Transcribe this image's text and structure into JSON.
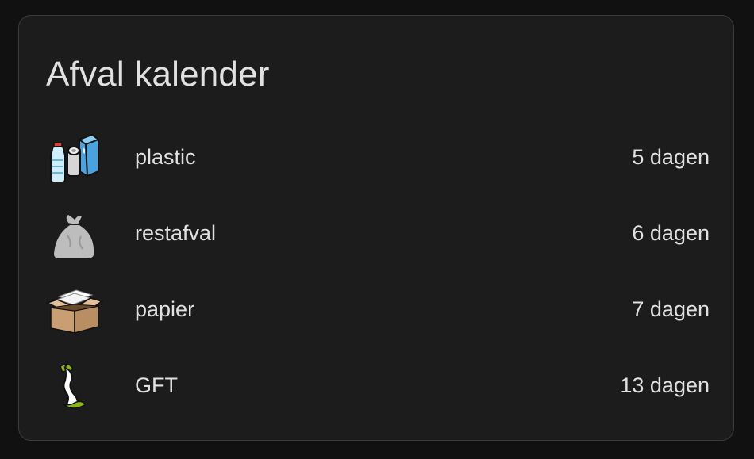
{
  "card": {
    "title": "Afval kalender",
    "items": [
      {
        "label": "plastic",
        "value": "5 dagen",
        "icon": "plastic-waste-icon"
      },
      {
        "label": "restafval",
        "value": "6 dagen",
        "icon": "trash-bag-icon"
      },
      {
        "label": "papier",
        "value": "7 dagen",
        "icon": "cardboard-box-icon"
      },
      {
        "label": "GFT",
        "value": "13 dagen",
        "icon": "apple-core-icon"
      }
    ]
  },
  "colors": {
    "page_background": "#111111",
    "card_background": "#1c1c1c",
    "card_border": "#3b3b3b",
    "text": "#e1e1e1",
    "gft_green": "#8db51a"
  }
}
